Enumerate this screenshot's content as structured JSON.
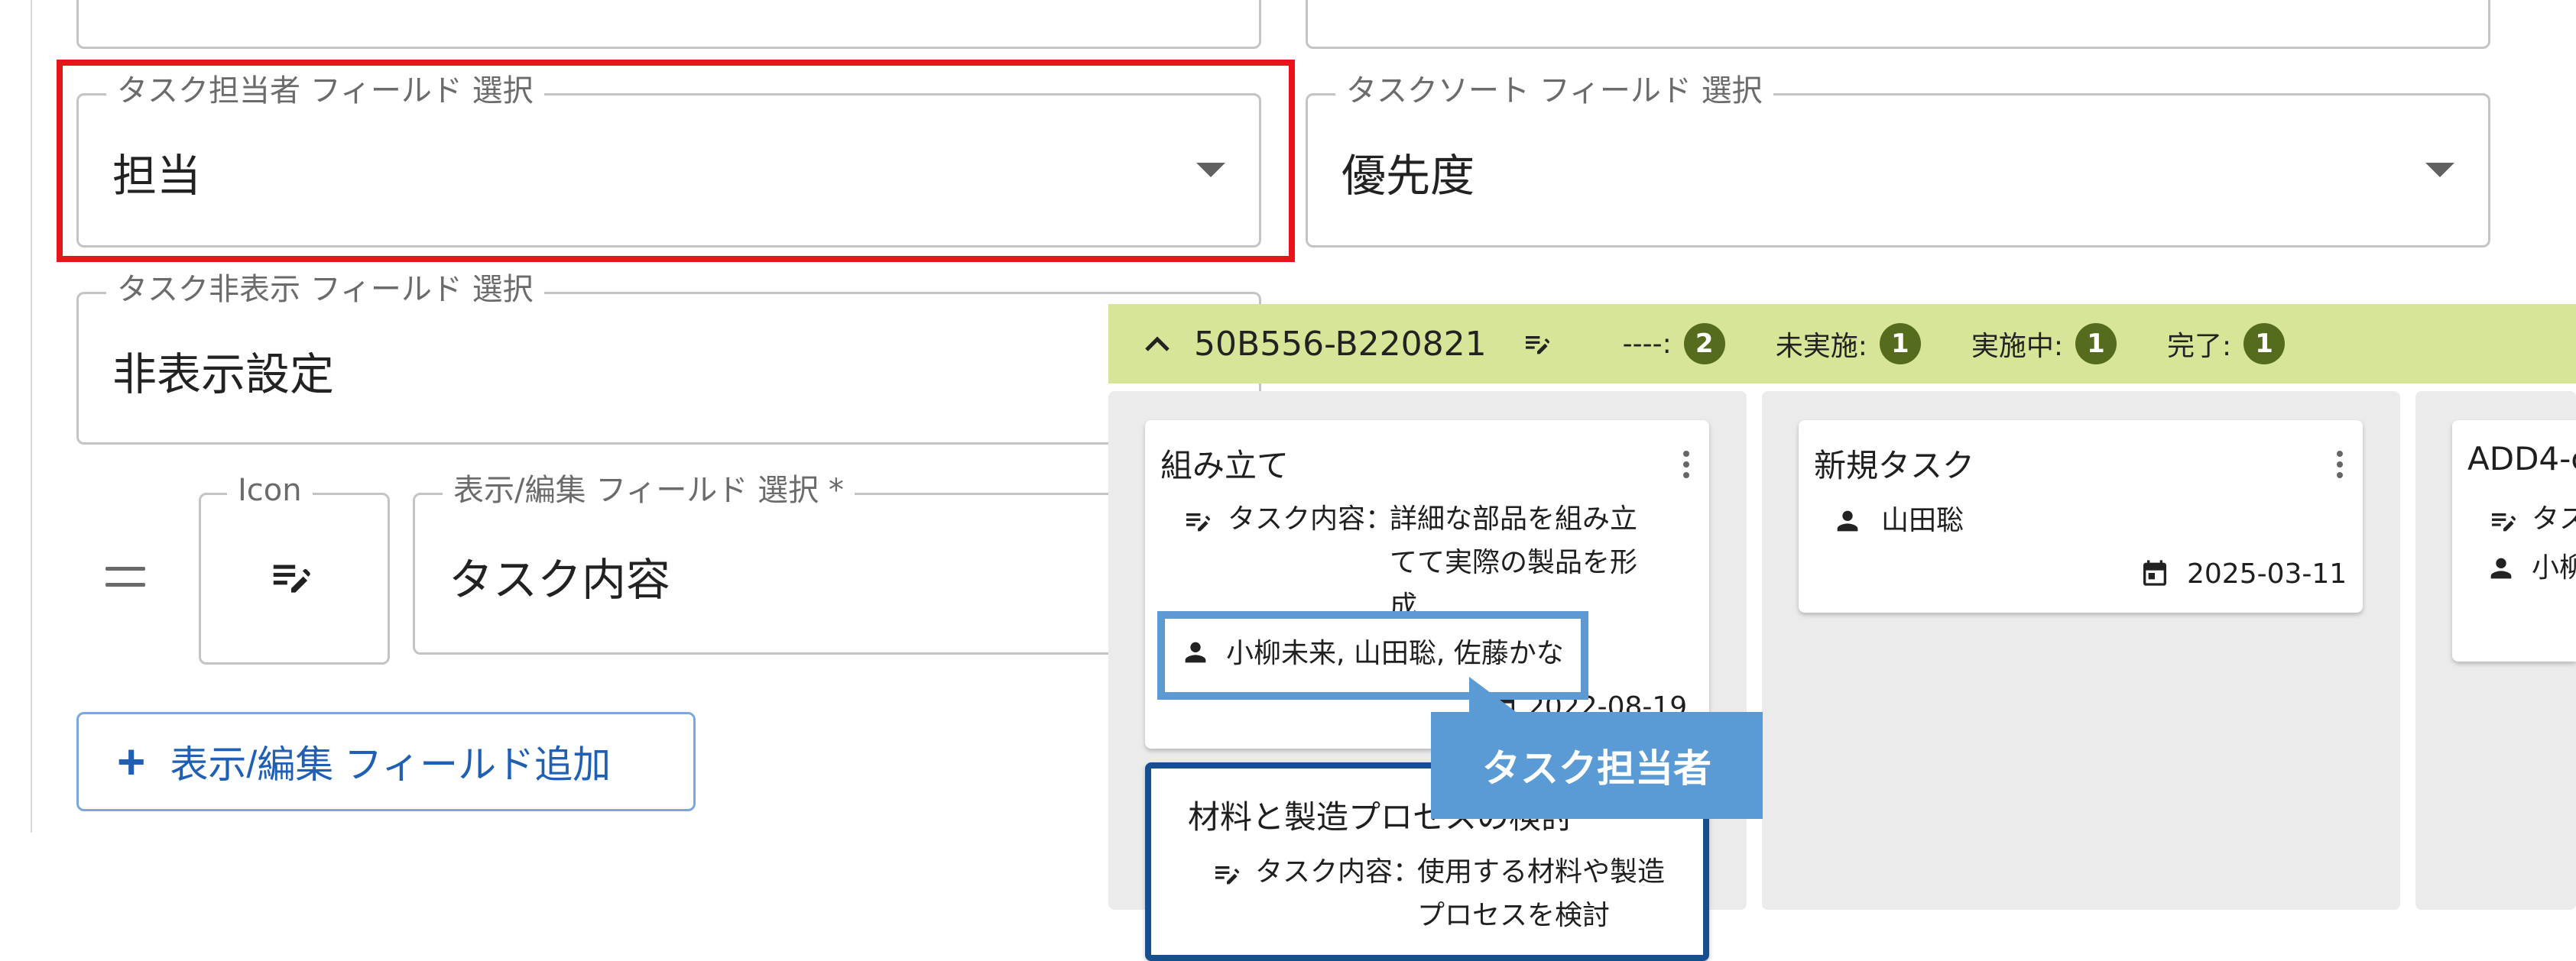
{
  "form": {
    "assignee_field": {
      "label": "タスク担当者 フィールド 選択",
      "value": "担当"
    },
    "sort_field": {
      "label": "タスクソート フィールド 選択",
      "value": "優先度"
    },
    "hidden_field": {
      "label": "タスク非表示 フィールド 選択",
      "value": "非表示設定"
    },
    "icon_field": {
      "label": "Icon"
    },
    "display_field": {
      "label": "表示/編集 フィールド 選択 *",
      "value": "タスク内容"
    },
    "add_button": {
      "label": "表示/編集 フィールド追加"
    }
  },
  "board": {
    "group_name": "50B556-B220821",
    "stats": [
      {
        "label": "----:",
        "count": "2"
      },
      {
        "label": "未実施:",
        "count": "1"
      },
      {
        "label": "実施中:",
        "count": "1"
      },
      {
        "label": "完了:",
        "count": "1"
      }
    ],
    "cards": {
      "assembly": {
        "title": "組み立て",
        "content_label": "タスク内容：",
        "content": "詳細な部品を組み立てて実際の製品を形成",
        "assignees": "小柳未来, 山田聡, 佐藤かな",
        "date": "2022-08-19"
      },
      "materials": {
        "title": "材料と製造プロセスの検討",
        "content_label": "タスク内容：",
        "content": "使用する材料や製造プロセスを検討"
      },
      "new_task": {
        "title": "新規タスク",
        "assignee": "山田聡",
        "date": "2025-03-11"
      },
      "add4": {
        "title": "ADD4-c",
        "content_label": "タス",
        "assignee": "小柳"
      }
    }
  },
  "callout": {
    "text": "タスク担当者"
  },
  "colors": {
    "highlight_red": "#e8141a",
    "highlight_blue": "#5d9ad3",
    "group_bar": "#d7e598",
    "badge": "#556b1e",
    "accent": "#1f5fb4"
  }
}
